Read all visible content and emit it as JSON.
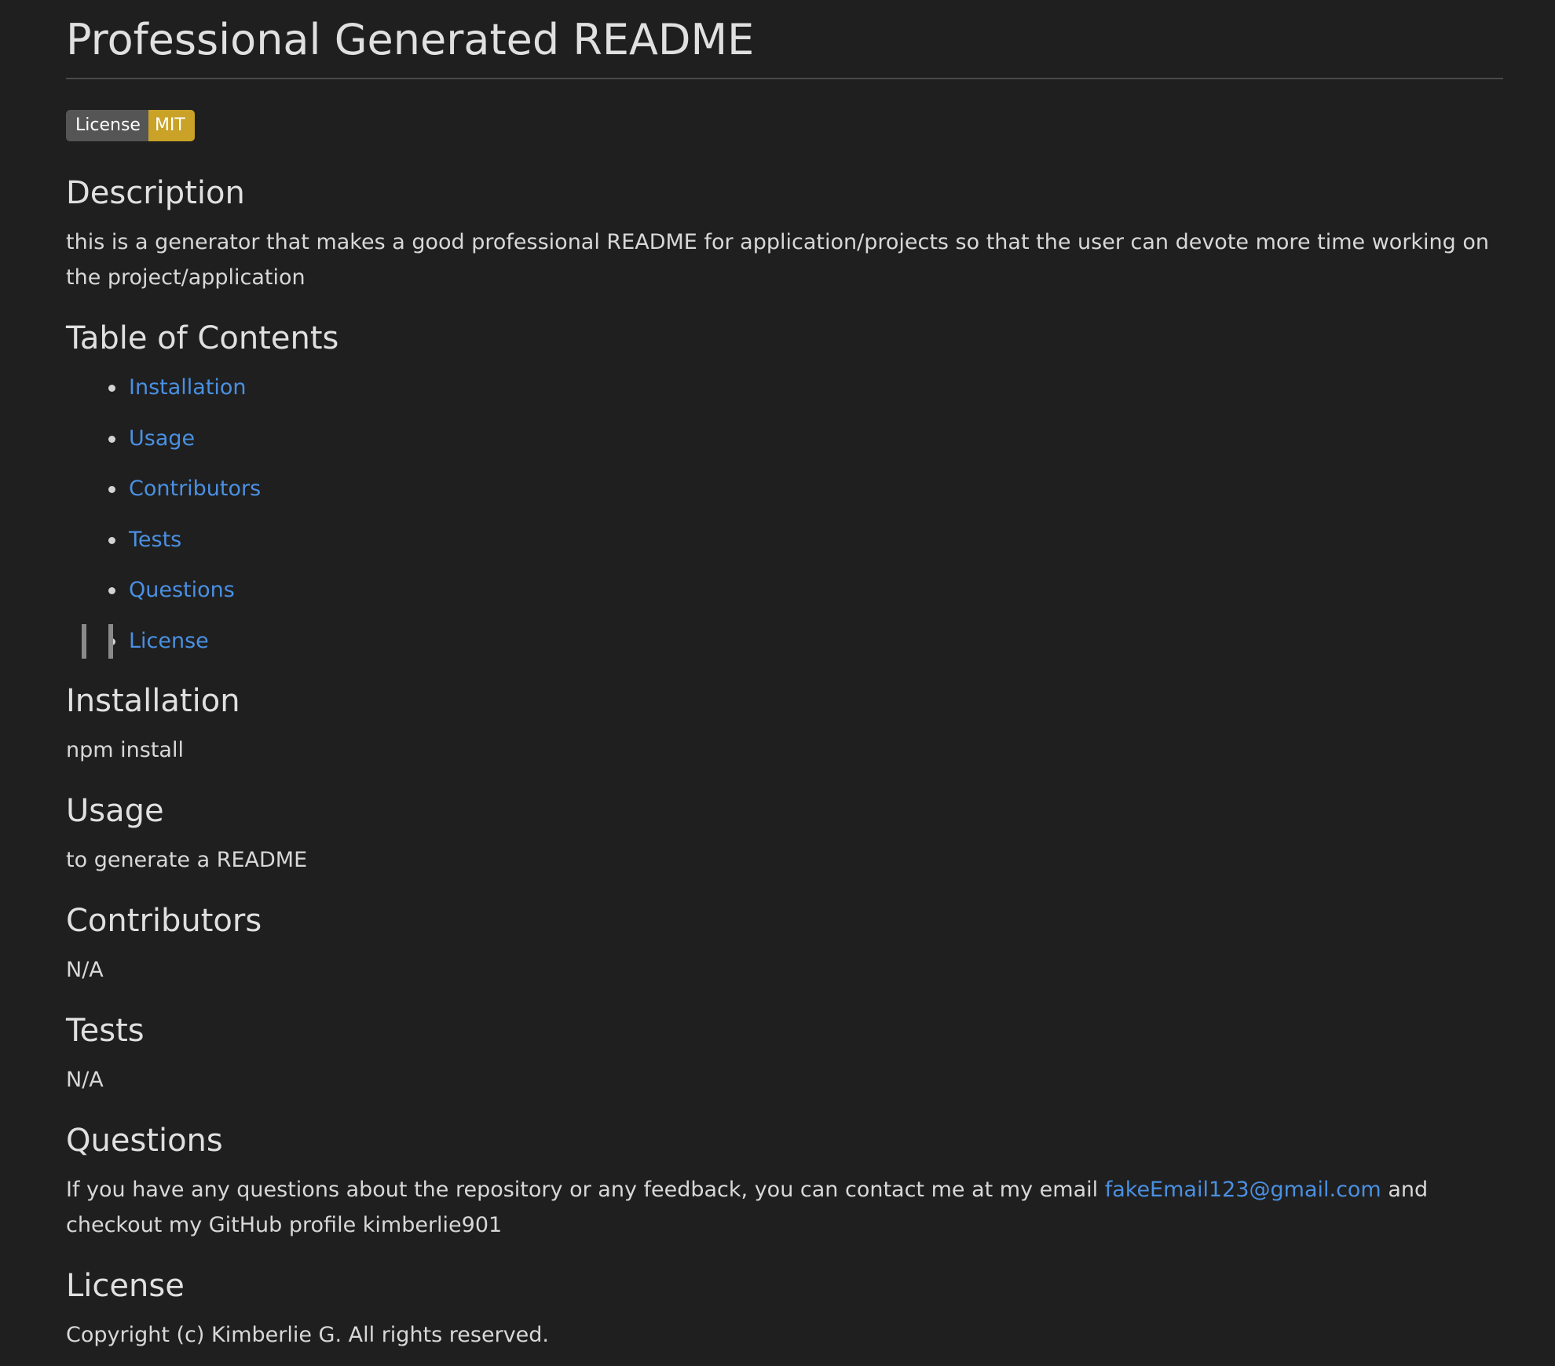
{
  "title": "Professional Generated README",
  "badge": {
    "label": "License",
    "value": "MIT",
    "label_color": "#555555",
    "value_color": "#c9a227"
  },
  "description": {
    "heading": "Description",
    "text": "this is a generator that makes a good professional README for application/projects so that the user can devote more time working on the project/application"
  },
  "toc": {
    "heading": "Table of Contents",
    "items": [
      "Installation",
      "Usage",
      "Contributors",
      "Tests",
      "Questions",
      "License"
    ]
  },
  "installation": {
    "heading": "Installation",
    "text": "npm install"
  },
  "usage": {
    "heading": "Usage",
    "text": "to generate a README"
  },
  "contributors": {
    "heading": "Contributors",
    "text": "N/A"
  },
  "tests": {
    "heading": "Tests",
    "text": "N/A"
  },
  "questions": {
    "heading": "Questions",
    "text_before": "If you have any questions about the repository or any feedback, you can contact me at my email ",
    "email": "fakeEmail123@gmail.com",
    "text_after": " and checkout my GitHub profile kimberlie901"
  },
  "license": {
    "heading": "License",
    "text": "Copyright (c) Kimberlie G. All rights reserved."
  },
  "colors": {
    "background": "#1f1f1f",
    "text": "#d4d4d4",
    "link": "#4a90e2"
  }
}
